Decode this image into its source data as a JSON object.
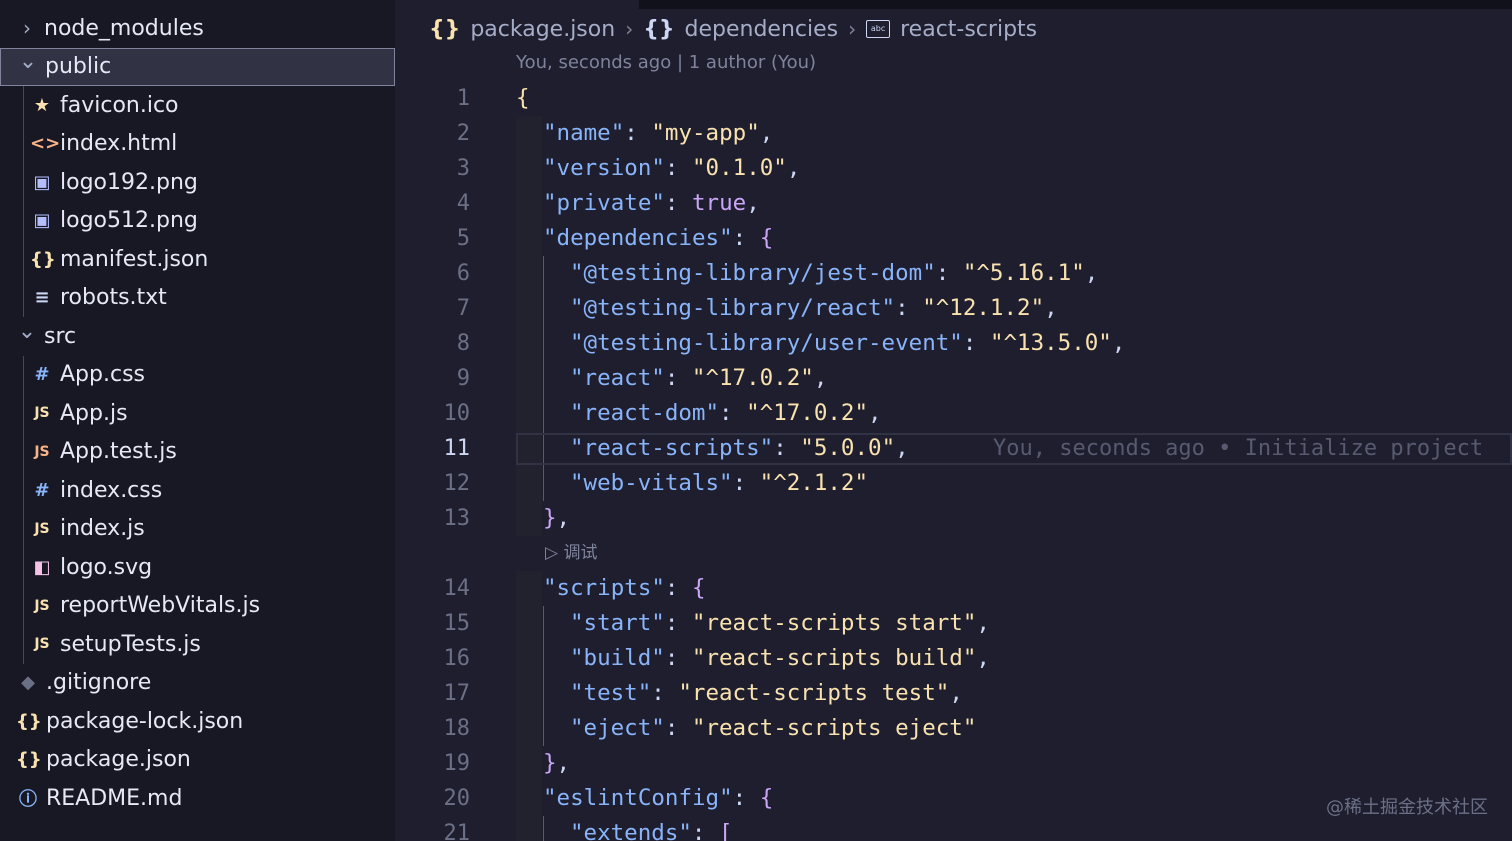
{
  "colors": {
    "accent": "#89b4fa",
    "string": "#f9e2af",
    "bracket": "#cba6f7",
    "background": "#1e1e2e",
    "sidebar": "#181825"
  },
  "explorer": {
    "items": [
      {
        "label": "node_modules",
        "type": "folder",
        "expanded": false,
        "icon": "chevron-right-icon"
      },
      {
        "label": "public",
        "type": "folder",
        "expanded": true,
        "selected": true,
        "icon": "chevron-down-icon"
      },
      {
        "label": "favicon.ico",
        "type": "file",
        "icon": "star-icon",
        "glyph": "★",
        "color": "#f9e2af"
      },
      {
        "label": "index.html",
        "type": "file",
        "icon": "html-icon",
        "glyph": "<>",
        "color": "#fab387"
      },
      {
        "label": "logo192.png",
        "type": "file",
        "icon": "image-icon",
        "glyph": "▣",
        "color": "#b4befe"
      },
      {
        "label": "logo512.png",
        "type": "file",
        "icon": "image-icon",
        "glyph": "▣",
        "color": "#b4befe"
      },
      {
        "label": "manifest.json",
        "type": "file",
        "icon": "json-icon",
        "glyph": "{}",
        "color": "#f9e2af"
      },
      {
        "label": "robots.txt",
        "type": "file",
        "icon": "text-file-icon",
        "glyph": "≡",
        "color": "#cdd6f4"
      },
      {
        "label": "src",
        "type": "folder",
        "expanded": true,
        "icon": "chevron-down-icon"
      },
      {
        "label": "App.css",
        "type": "file",
        "icon": "css-icon",
        "glyph": "#",
        "color": "#89b4fa"
      },
      {
        "label": "App.js",
        "type": "file",
        "icon": "js-icon",
        "glyph": "JS",
        "color": "#f9e2af"
      },
      {
        "label": "App.test.js",
        "type": "file",
        "icon": "js-test-icon",
        "glyph": "JS",
        "color": "#fab387"
      },
      {
        "label": "index.css",
        "type": "file",
        "icon": "css-icon",
        "glyph": "#",
        "color": "#89b4fa"
      },
      {
        "label": "index.js",
        "type": "file",
        "icon": "js-icon",
        "glyph": "JS",
        "color": "#f9e2af"
      },
      {
        "label": "logo.svg",
        "type": "file",
        "icon": "svg-icon",
        "glyph": "◧",
        "color": "#f5c2e7"
      },
      {
        "label": "reportWebVitals.js",
        "type": "file",
        "icon": "js-icon",
        "glyph": "JS",
        "color": "#f9e2af"
      },
      {
        "label": "setupTests.js",
        "type": "file",
        "icon": "js-icon",
        "glyph": "JS",
        "color": "#f9e2af"
      },
      {
        "label": ".gitignore",
        "type": "file",
        "icon": "git-icon",
        "glyph": "◆",
        "color": "#6c7086"
      },
      {
        "label": "package-lock.json",
        "type": "file",
        "icon": "json-icon",
        "glyph": "{}",
        "color": "#f9e2af"
      },
      {
        "label": "package.json",
        "type": "file",
        "icon": "json-icon",
        "glyph": "{}",
        "color": "#f9e2af"
      },
      {
        "label": "README.md",
        "type": "file",
        "icon": "info-icon",
        "glyph": "ⓘ",
        "color": "#89b4fa"
      }
    ]
  },
  "breadcrumb": {
    "file": "package.json",
    "object": "dependencies",
    "key": "react-scripts",
    "file_icon": "{}",
    "object_icon": "{}",
    "key_icon": "abc"
  },
  "blame_header": "You, seconds ago | 1 author (You)",
  "inline_blame": "You, seconds ago • Initialize project",
  "codelens": "▷ 调试",
  "current_line": 11,
  "code_lines": [
    {
      "n": "1",
      "indent": 0,
      "tokens": [
        [
          "br1",
          "{"
        ]
      ]
    },
    {
      "n": "2",
      "indent": 1,
      "tokens": [
        [
          "k",
          "\"name\""
        ],
        [
          "p",
          ": "
        ],
        [
          "s",
          "\"my-app\""
        ],
        [
          "p",
          ","
        ]
      ]
    },
    {
      "n": "3",
      "indent": 1,
      "tokens": [
        [
          "k",
          "\"version\""
        ],
        [
          "p",
          ": "
        ],
        [
          "s",
          "\"0.1.0\""
        ],
        [
          "p",
          ","
        ]
      ]
    },
    {
      "n": "4",
      "indent": 1,
      "tokens": [
        [
          "k",
          "\"private\""
        ],
        [
          "p",
          ": "
        ],
        [
          "t",
          "true"
        ],
        [
          "p",
          ","
        ]
      ]
    },
    {
      "n": "5",
      "indent": 1,
      "tokens": [
        [
          "k",
          "\"dependencies\""
        ],
        [
          "p",
          ": "
        ],
        [
          "b",
          "{"
        ]
      ]
    },
    {
      "n": "6",
      "indent": 2,
      "tokens": [
        [
          "k",
          "\"@testing-library/jest-dom\""
        ],
        [
          "p",
          ": "
        ],
        [
          "s",
          "\"^5.16.1\""
        ],
        [
          "p",
          ","
        ]
      ]
    },
    {
      "n": "7",
      "indent": 2,
      "tokens": [
        [
          "k",
          "\"@testing-library/react\""
        ],
        [
          "p",
          ": "
        ],
        [
          "s",
          "\"^12.1.2\""
        ],
        [
          "p",
          ","
        ]
      ]
    },
    {
      "n": "8",
      "indent": 2,
      "tokens": [
        [
          "k",
          "\"@testing-library/user-event\""
        ],
        [
          "p",
          ": "
        ],
        [
          "s",
          "\"^13.5.0\""
        ],
        [
          "p",
          ","
        ]
      ]
    },
    {
      "n": "9",
      "indent": 2,
      "tokens": [
        [
          "k",
          "\"react\""
        ],
        [
          "p",
          ": "
        ],
        [
          "s",
          "\"^17.0.2\""
        ],
        [
          "p",
          ","
        ]
      ]
    },
    {
      "n": "10",
      "indent": 2,
      "tokens": [
        [
          "k",
          "\"react-dom\""
        ],
        [
          "p",
          ": "
        ],
        [
          "s",
          "\"^17.0.2\""
        ],
        [
          "p",
          ","
        ]
      ]
    },
    {
      "n": "11",
      "indent": 2,
      "tokens": [
        [
          "k",
          "\"react-scripts\""
        ],
        [
          "p",
          ": "
        ],
        [
          "s",
          "\"5.0.0\""
        ],
        [
          "p",
          ","
        ]
      ]
    },
    {
      "n": "12",
      "indent": 2,
      "tokens": [
        [
          "k",
          "\"web-vitals\""
        ],
        [
          "p",
          ": "
        ],
        [
          "s",
          "\"^2.1.2\""
        ]
      ]
    },
    {
      "n": "13",
      "indent": 1,
      "tokens": [
        [
          "b",
          "}"
        ],
        [
          "p",
          ","
        ]
      ]
    },
    {
      "n": "14",
      "indent": 1,
      "tokens": [
        [
          "k",
          "\"scripts\""
        ],
        [
          "p",
          ": "
        ],
        [
          "b",
          "{"
        ]
      ]
    },
    {
      "n": "15",
      "indent": 2,
      "tokens": [
        [
          "k",
          "\"start\""
        ],
        [
          "p",
          ": "
        ],
        [
          "s",
          "\"react-scripts start\""
        ],
        [
          "p",
          ","
        ]
      ]
    },
    {
      "n": "16",
      "indent": 2,
      "tokens": [
        [
          "k",
          "\"build\""
        ],
        [
          "p",
          ": "
        ],
        [
          "s",
          "\"react-scripts build\""
        ],
        [
          "p",
          ","
        ]
      ]
    },
    {
      "n": "17",
      "indent": 2,
      "tokens": [
        [
          "k",
          "\"test\""
        ],
        [
          "p",
          ": "
        ],
        [
          "s",
          "\"react-scripts test\""
        ],
        [
          "p",
          ","
        ]
      ]
    },
    {
      "n": "18",
      "indent": 2,
      "tokens": [
        [
          "k",
          "\"eject\""
        ],
        [
          "p",
          ": "
        ],
        [
          "s",
          "\"react-scripts eject\""
        ]
      ]
    },
    {
      "n": "19",
      "indent": 1,
      "tokens": [
        [
          "b",
          "}"
        ],
        [
          "p",
          ","
        ]
      ]
    },
    {
      "n": "20",
      "indent": 1,
      "tokens": [
        [
          "k",
          "\"eslintConfig\""
        ],
        [
          "p",
          ": "
        ],
        [
          "b",
          "{"
        ]
      ]
    },
    {
      "n": "21",
      "indent": 2,
      "tokens": [
        [
          "k",
          "\"extends\""
        ],
        [
          "p",
          ": "
        ],
        [
          "b",
          "["
        ]
      ]
    }
  ],
  "watermark": "@稀土掘金技术社区"
}
